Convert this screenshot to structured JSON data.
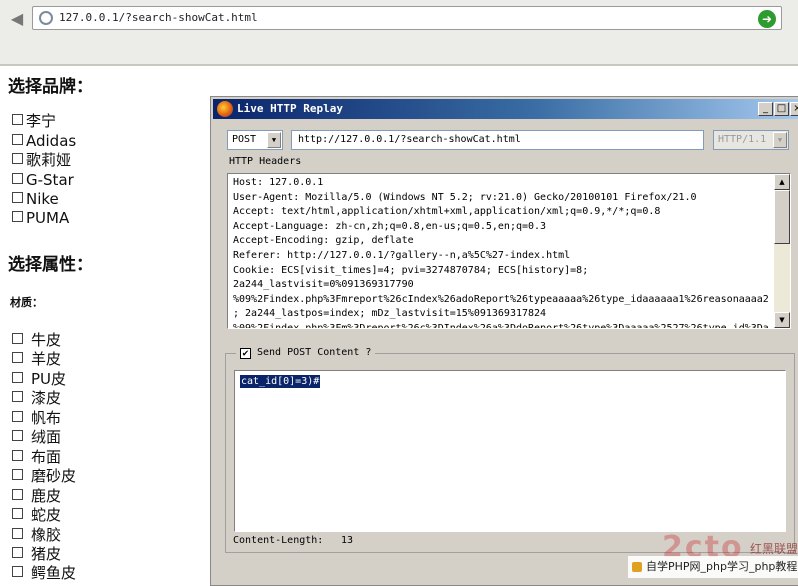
{
  "browser": {
    "url": "127.0.0.1/?search-showCat.html"
  },
  "page": {
    "brand_heading": "选择品牌：",
    "brands": [
      "李宁",
      "Adidas",
      "歌莉娅",
      "G-Star",
      "Nike",
      "PUMA"
    ],
    "attr_heading": "选择属性：",
    "material_label": "材质：",
    "materials": [
      "牛皮",
      "羊皮",
      "PU皮",
      "漆皮",
      "帆布",
      "绒面",
      "布面",
      "磨砂皮",
      "鹿皮",
      "蛇皮",
      "橡胶",
      "猪皮",
      "鳄鱼皮"
    ]
  },
  "dialog": {
    "title": "Live HTTP Replay",
    "method": "POST",
    "request_url": "http://127.0.0.1/?search-showCat.html",
    "http_version": "HTTP/1.1",
    "headers_label": "HTTP Headers",
    "headers_lines": [
      "Host: 127.0.0.1",
      "User-Agent: Mozilla/5.0 (Windows NT 5.2; rv:21.0) Gecko/20100101 Firefox/21.0",
      "Accept: text/html,application/xhtml+xml,application/xml;q=0.9,*/*;q=0.8",
      "Accept-Language: zh-cn,zh;q=0.8,en-us;q=0.5,en;q=0.3",
      "Accept-Encoding: gzip, deflate",
      "Referer: http://127.0.0.1/?gallery--n,a%5C%27-index.html",
      "Cookie: ECS[visit_times]=4; pvi=3274870784; ECS[history]=8;",
      "2a244_lastvisit=0%091369317790",
      "%09%2Findex.php%3Fmreport%26cIndex%26adoReport%26typeaaaaa%26type_idaaaaaa1%26reasonaaaa2",
      "; 2a244_lastpos=index; mDz_lastvisit=15%091369317824",
      "%09%2Findex.php%3Fm%3Dreport%26c%3DIndex%26a%3DdoReport%26type%3Daaaaa%2527%26type_id%3Da"
    ],
    "send_post_label": "Send POST Content ?",
    "send_post_checked": true,
    "post_content": "cat_id[0]=3)#",
    "content_length_label": "Content-Length:",
    "content_length_value": "13"
  },
  "watermark": {
    "logo": "2cto",
    "logo_sub": "红黑联盟",
    "bar_text": "自学PHP网_php学习_php教程"
  },
  "colors": {
    "titlebar_start": "#0a246a",
    "dialog_bg": "#d4d0c8",
    "selection": "#0a246a",
    "go_button": "#2d9b2d"
  }
}
